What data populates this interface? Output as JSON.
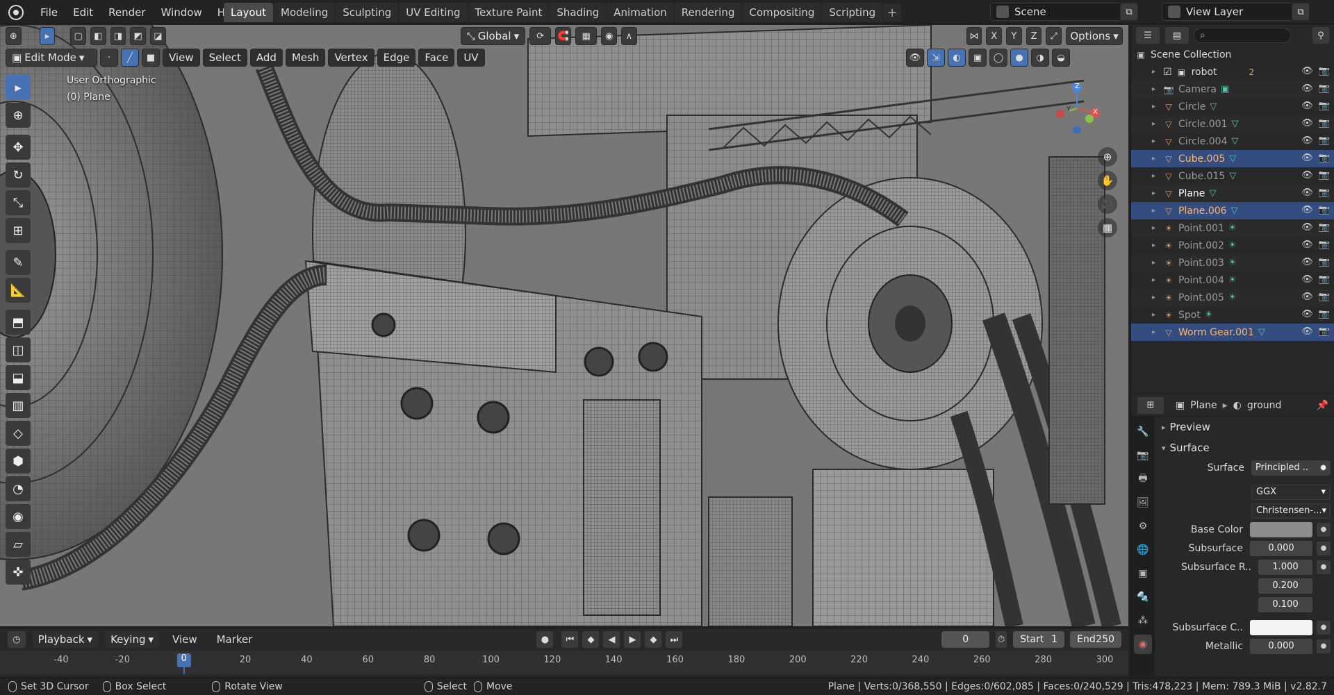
{
  "topbar": {
    "menus": [
      "File",
      "Edit",
      "Render",
      "Window",
      "Help"
    ],
    "tabs": [
      "Layout",
      "Modeling",
      "Sculpting",
      "UV Editing",
      "Texture Paint",
      "Shading",
      "Animation",
      "Rendering",
      "Compositing",
      "Scripting"
    ],
    "active_tab": "Layout",
    "add_tab": "+",
    "scene": "Scene",
    "view_layer": "View Layer"
  },
  "viewport": {
    "mode": "Edit Mode",
    "menus": [
      "View",
      "Select",
      "Add",
      "Mesh",
      "Vertex",
      "Edge",
      "Face",
      "UV"
    ],
    "transform_orientation": "Global",
    "axes": [
      "X",
      "Y",
      "Z"
    ],
    "options": "Options",
    "view_name": "User Orthographic",
    "object_name": "(0) Plane",
    "gizmo_axes": {
      "x": "X",
      "y": "Y",
      "z": "Z"
    }
  },
  "outliner": {
    "root": "Scene Collection",
    "items": [
      {
        "name": "robot",
        "kind": "collection"
      },
      {
        "name": "Camera",
        "kind": "camera"
      },
      {
        "name": "Circle",
        "kind": "mesh"
      },
      {
        "name": "Circle.001",
        "kind": "mesh"
      },
      {
        "name": "Circle.004",
        "kind": "mesh"
      },
      {
        "name": "Cube.005",
        "kind": "mesh",
        "selected": true
      },
      {
        "name": "Cube.015",
        "kind": "mesh"
      },
      {
        "name": "Plane",
        "kind": "mesh",
        "active": true
      },
      {
        "name": "Plane.006",
        "kind": "mesh",
        "selected": true
      },
      {
        "name": "Point.001",
        "kind": "light"
      },
      {
        "name": "Point.002",
        "kind": "light"
      },
      {
        "name": "Point.003",
        "kind": "light"
      },
      {
        "name": "Point.004",
        "kind": "light"
      },
      {
        "name": "Point.005",
        "kind": "light"
      },
      {
        "name": "Spot",
        "kind": "light"
      },
      {
        "name": "Worm Gear.001",
        "kind": "mesh",
        "selected": true
      }
    ],
    "robot_badge": "2"
  },
  "properties": {
    "object": "Plane",
    "material": "ground",
    "panels": {
      "preview": "Preview",
      "surface": "Surface"
    },
    "fields": {
      "surface_label": "Surface",
      "surface_value": "Principled ..",
      "distribution": "GGX",
      "subsurface_method": "Christensen-...",
      "base_color_label": "Base Color",
      "subsurface_label": "Subsurface",
      "subsurface_value": "0.000",
      "subsurface_radius_label": "Subsurface R..",
      "subsurface_radius": [
        "1.000",
        "0.200",
        "0.100"
      ],
      "subsurface_color_label": "Subsurface C..",
      "metallic_label": "Metallic",
      "metallic_value": "0.000"
    },
    "colors": {
      "base_color": "#8c8c8c",
      "subsurface_color": "#f4f4f4"
    }
  },
  "timeline": {
    "menus": [
      "Playback",
      "Keying",
      "View",
      "Marker"
    ],
    "current_frame": "0",
    "start_label": "Start",
    "start": "1",
    "end_label": "End",
    "end": "250",
    "ticks": [
      "-40",
      "-20",
      "0",
      "20",
      "40",
      "60",
      "80",
      "100",
      "120",
      "140",
      "160",
      "180",
      "200",
      "220",
      "240",
      "260",
      "280",
      "300"
    ]
  },
  "statusbar": {
    "items": [
      "Set 3D Cursor",
      "Box Select",
      "Rotate View",
      "Select",
      "Move"
    ],
    "stats": "Plane | Verts:0/368,550 | Edges:0/602,085 | Faces:0/240,529 | Tris:478,223 | Mem: 789.3 MiB | v2.82.7"
  },
  "theme": {
    "accent": "#4772b3",
    "selected_row": "#334d80",
    "viewport_bg": "#6b6b6b"
  }
}
